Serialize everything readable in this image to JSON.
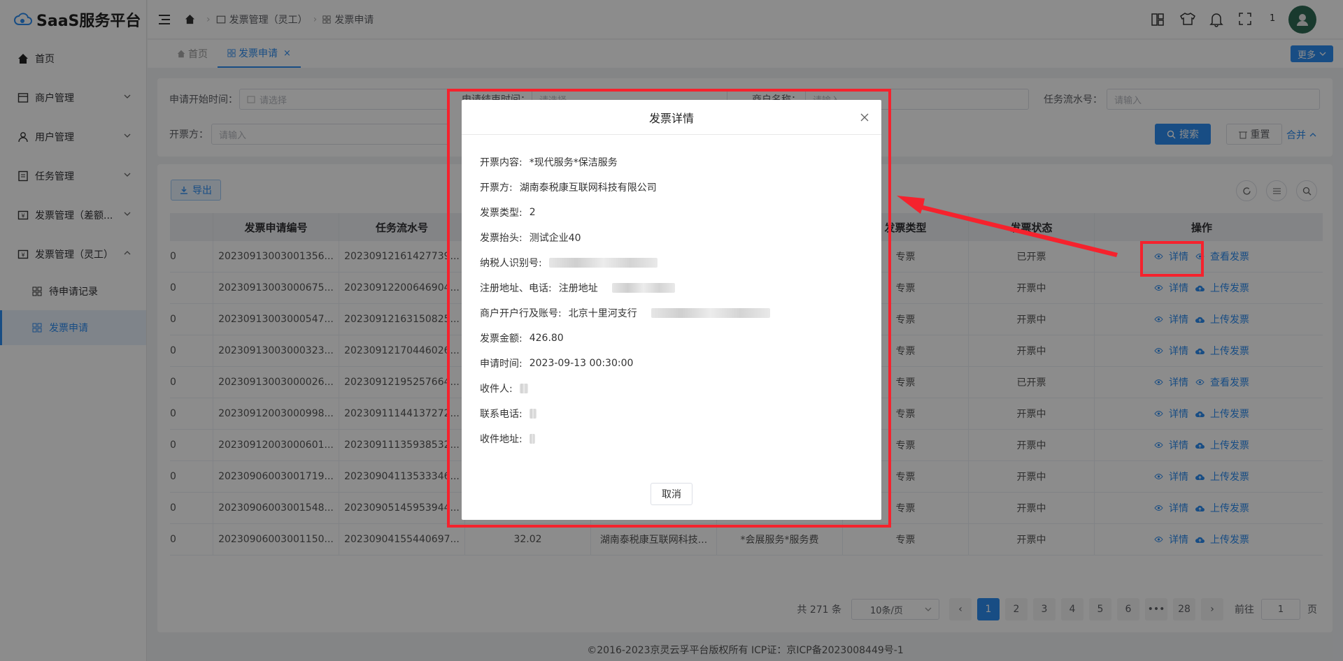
{
  "app": {
    "title": "SaaS服务平台"
  },
  "sidebar": {
    "items": [
      {
        "label": "首页",
        "icon": "home-icon"
      },
      {
        "label": "商户管理",
        "icon": "shop-icon"
      },
      {
        "label": "用户管理",
        "icon": "user-icon"
      },
      {
        "label": "任务管理",
        "icon": "task-icon"
      },
      {
        "label": "发票管理（差额...",
        "icon": "invoice-icon"
      },
      {
        "label": "发票管理（灵工）",
        "icon": "invoice-icon"
      }
    ],
    "subitems": [
      {
        "label": "待申请记录"
      },
      {
        "label": "发票申请"
      }
    ]
  },
  "header": {
    "breadcrumb": [
      "发票管理（灵工）",
      "发票申请"
    ],
    "count": "1"
  },
  "tabs": [
    {
      "label": "首页"
    },
    {
      "label": "发票申请"
    }
  ],
  "more_label": "更多",
  "filters": {
    "start_label": "申请开始时间：",
    "start_placeholder": "请选择",
    "end_label": "申请结束时间：",
    "end_placeholder": "请选择",
    "merchant_label": "商户名称：",
    "merchant_placeholder": "请输入",
    "serial_label": "任务流水号：",
    "serial_placeholder": "请输入",
    "issuer_label": "开票方：",
    "issuer_placeholder": "请输入",
    "search": "搜索",
    "reset": "重置",
    "collapse": "合并"
  },
  "export_label": "导出",
  "table": {
    "columns": [
      "发票申请编号",
      "任务流水号",
      "发票类型",
      "发票状态",
      "操作"
    ],
    "rows": [
      {
        "c0": "0",
        "id": "20230913003001356...",
        "serial": "20230912161427739...",
        "amount": "",
        "issuer": "",
        "content": "",
        "type": "专票",
        "status": "已开票",
        "action": "查看发票"
      },
      {
        "c0": "0",
        "id": "20230913003000675...",
        "serial": "20230912200646904...",
        "amount": "",
        "issuer": "",
        "content": "",
        "type": "专票",
        "status": "开票中",
        "action": "上传发票"
      },
      {
        "c0": "0",
        "id": "20230913003000547...",
        "serial": "20230912163150825...",
        "amount": "",
        "issuer": "",
        "content": "",
        "type": "专票",
        "status": "开票中",
        "action": "上传发票"
      },
      {
        "c0": "0",
        "id": "20230913003000323...",
        "serial": "20230912170446026...",
        "amount": "",
        "issuer": "",
        "content": "",
        "type": "专票",
        "status": "开票中",
        "action": "上传发票"
      },
      {
        "c0": "0",
        "id": "20230913003000026...",
        "serial": "20230912195257664...",
        "amount": "",
        "issuer": "",
        "content": "",
        "type": "专票",
        "status": "已开票",
        "action": "查看发票"
      },
      {
        "c0": "0",
        "id": "20230912003000998...",
        "serial": "20230911144137272...",
        "amount": "",
        "issuer": "",
        "content": "",
        "type": "专票",
        "status": "开票中",
        "action": "上传发票"
      },
      {
        "c0": "0",
        "id": "20230912003000601...",
        "serial": "20230911135938532...",
        "amount": "",
        "issuer": "",
        "content": "",
        "type": "专票",
        "status": "开票中",
        "action": "上传发票"
      },
      {
        "c0": "0",
        "id": "20230906003001719...",
        "serial": "20230904113533346...",
        "amount": "",
        "issuer": "",
        "content": "",
        "type": "专票",
        "status": "开票中",
        "action": "上传发票"
      },
      {
        "c0": "0",
        "id": "20230906003001548...",
        "serial": "20230905145953944...",
        "amount": "",
        "issuer": "",
        "content": "",
        "type": "专票",
        "status": "开票中",
        "action": "上传发票"
      },
      {
        "c0": "0",
        "id": "20230906003001150...",
        "serial": "20230904155440697...",
        "amount": "32.02",
        "issuer": "湖南泰税康互联网科技...",
        "content": "*会展服务*服务费",
        "type": "专票",
        "status": "开票中",
        "action": "上传发票"
      }
    ],
    "detail_label": "详情"
  },
  "pagination": {
    "total": "共 271 条",
    "page_size": "10条/页",
    "pages": [
      "1",
      "2",
      "3",
      "4",
      "5",
      "6",
      "•••",
      "28"
    ],
    "goto_label": "前往",
    "goto_value": "1",
    "page_unit": "页"
  },
  "footer": "©2016-2023京灵云孚平台版权所有 ICP证：京ICP备2023008449号-1",
  "modal": {
    "title": "发票详情",
    "fields": [
      {
        "label": "开票内容:",
        "value": "*现代服务*保洁服务"
      },
      {
        "label": "开票方:",
        "value": "湖南泰税康互联网科技有限公司"
      },
      {
        "label": "发票类型:",
        "value": "2"
      },
      {
        "label": "发票抬头:",
        "value": "测试企业40"
      },
      {
        "label": "纳税人识别号:",
        "value": ""
      },
      {
        "label": "注册地址、电话:",
        "value": "注册地址"
      },
      {
        "label": "商户开户行及账号:",
        "value": "北京十里河支行"
      },
      {
        "label": "发票金额:",
        "value": "426.80"
      },
      {
        "label": "申请时间:",
        "value": "2023-09-13 00:30:00"
      },
      {
        "label": "收件人:",
        "value": ""
      },
      {
        "label": "联系电话:",
        "value": ""
      },
      {
        "label": "收件地址:",
        "value": ""
      }
    ],
    "cancel": "取消"
  },
  "colors": {
    "primary": "#2d8cf0",
    "highlight": "#f5222d"
  }
}
